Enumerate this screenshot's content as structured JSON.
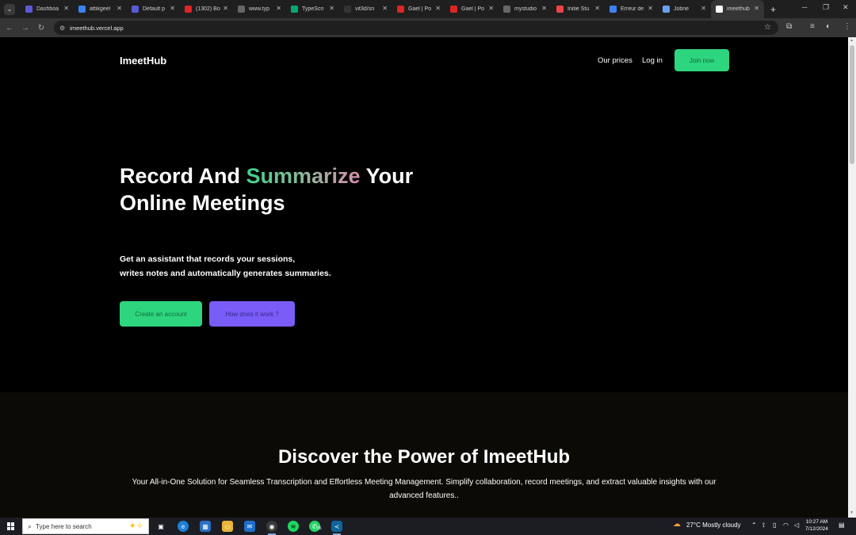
{
  "browser": {
    "tabs": [
      {
        "title": "Dashboa",
        "icon": "halo-icon",
        "color": "#5b5bd6"
      },
      {
        "title": "attikgeel",
        "icon": "globe-icon",
        "color": "#3b82f6"
      },
      {
        "title": "Default p",
        "icon": "halo-icon",
        "color": "#5b5bd6"
      },
      {
        "title": "(1302) Bo",
        "icon": "youtube-icon",
        "color": "#e02424"
      },
      {
        "title": "www.typ",
        "icon": "web-icon",
        "color": "#666"
      },
      {
        "title": "TypeScri",
        "icon": "w3schools-icon",
        "color": "#04aa6d"
      },
      {
        "title": "vit3d/sn",
        "icon": "github-icon",
        "color": "#333"
      },
      {
        "title": "Gael | Po",
        "icon": "gael-icon",
        "color": "#dc2626"
      },
      {
        "title": "Gael | Po",
        "icon": "gael-icon",
        "color": "#dc2626"
      },
      {
        "title": "mystudio",
        "icon": "web-icon",
        "color": "#666"
      },
      {
        "title": "Initie Stu",
        "icon": "studio-icon",
        "color": "#ef4444"
      },
      {
        "title": "Erreur de",
        "icon": "doc-icon",
        "color": "#3b82f6"
      },
      {
        "title": "Jobrie",
        "icon": "jobrie-icon",
        "color": "#6aa0f8"
      },
      {
        "title": "imeethub",
        "icon": "vercel-icon",
        "color": "#ffffff",
        "active": true
      }
    ],
    "url": "imeethub.vercel.app"
  },
  "page": {
    "brand": "ImeetHub",
    "nav": {
      "prices": "Our prices",
      "login": "Log in",
      "join": "Join now"
    },
    "hero": {
      "title_part1": "Record And ",
      "title_highlight": "Summarize",
      "title_part2": " Your",
      "title_line2": "Online Meetings",
      "sub_line1": "Get an assistant that records your sessions,",
      "sub_line2": "writes notes and automatically generates summaries.",
      "btn_create": "Create an account",
      "btn_how": "How does it work ?"
    },
    "section2": {
      "title": "Discover the Power of ImeetHub",
      "text": "Your All-in-One Solution for Seamless Transcription and Effortless Meeting Management. Simplify collaboration, record meetings, and extract valuable insights with our advanced features.."
    },
    "colors": {
      "accent_green": "#2ed57f",
      "accent_purple": "#7a5cf8"
    }
  },
  "taskbar": {
    "search_placeholder": "Type here to search",
    "whatsapp_badge": "95",
    "weather": "27°C  Mostly cloudy",
    "time": "10:27 AM",
    "date": "7/12/2024"
  }
}
